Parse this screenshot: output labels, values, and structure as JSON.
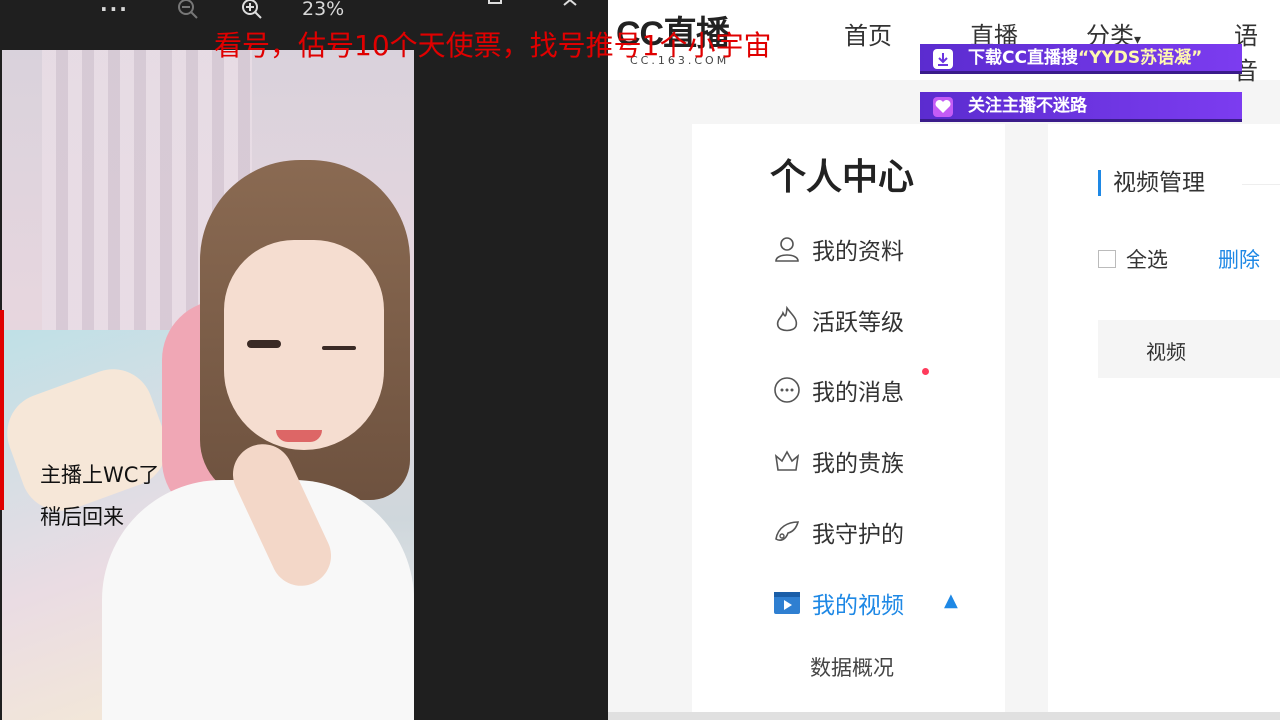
{
  "viewer": {
    "toolbar": {
      "more": "···",
      "zoom_level": "23%",
      "icons": [
        "more-icon",
        "zoom-out-icon",
        "zoom-in-icon",
        "maximize-icon",
        "close-icon"
      ]
    },
    "overlay": {
      "line1": "主播上WC了",
      "line2": "稍后回来"
    }
  },
  "red_banner_text": "看号，估号10个天使票，找号推号1个小宇宙",
  "web": {
    "logo": {
      "text": "CC直播",
      "subtext": "CC.163.COM"
    },
    "nav": {
      "home": "首页",
      "live": "直播",
      "category": "分类",
      "voice": "语音"
    },
    "banners": {
      "download_prefix": "下载CC直播搜",
      "download_highlight": "“YYDS苏语凝”",
      "follow": "关注主播不迷路"
    },
    "sidebar": {
      "title": "个人中心",
      "items": [
        {
          "label": "我的资料",
          "icon": "user-icon"
        },
        {
          "label": "活跃等级",
          "icon": "flame-icon"
        },
        {
          "label": "我的消息",
          "icon": "chat-icon"
        },
        {
          "label": "我的贵族",
          "icon": "crown-icon"
        },
        {
          "label": "我守护的",
          "icon": "wing-icon"
        },
        {
          "label": "我的视频",
          "icon": "video-icon"
        }
      ],
      "sub_item": "数据概况"
    },
    "content": {
      "title": "视频管理",
      "select_all": "全选",
      "delete": "删除",
      "table_header": "视频"
    },
    "colors": {
      "accent": "#1e88e5",
      "banner": "#6b34e0",
      "red_text": "#e00000"
    }
  }
}
